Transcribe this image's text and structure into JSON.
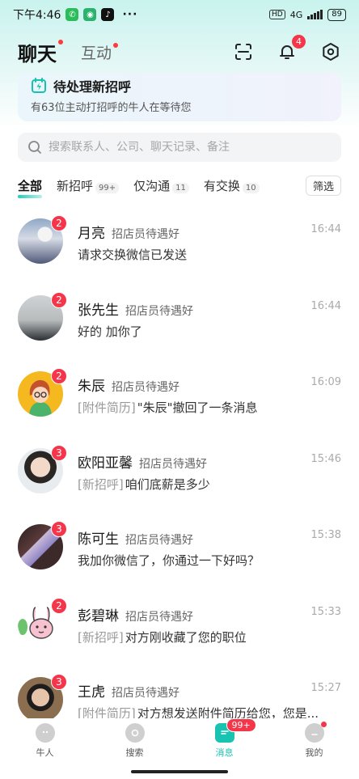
{
  "status_bar": {
    "time": "下午4:46",
    "hd": "HD",
    "network": "4G",
    "battery": "89"
  },
  "header": {
    "tab_chat": "聊天",
    "tab_interact": "互动",
    "notification_count": "4"
  },
  "pending_card": {
    "title": "待处理新招呼",
    "subtitle": "有63位主动打招呼的牛人在等待您"
  },
  "search": {
    "placeholder": "搜索联系人、公司、聊天记录、备注"
  },
  "filter_tabs": [
    {
      "label": "全部",
      "count": ""
    },
    {
      "label": "新招呼",
      "count": "99+"
    },
    {
      "label": "仅沟通",
      "count": "11"
    },
    {
      "label": "有交换",
      "count": "10"
    }
  ],
  "filter_button": "筛选",
  "chats": [
    {
      "name": "月亮",
      "role": "招店员待遇好",
      "time": "16:44",
      "unread": "2",
      "tag": "",
      "message": "请求交换微信已发送"
    },
    {
      "name": "张先生",
      "role": "招店员待遇好",
      "time": "16:44",
      "unread": "2",
      "tag": "",
      "message": "好的 加你了"
    },
    {
      "name": "朱辰",
      "role": "招店员待遇好",
      "time": "16:09",
      "unread": "2",
      "tag": "[附件简历]",
      "message": "\"朱辰\"撤回了一条消息"
    },
    {
      "name": "欧阳亚馨",
      "role": "招店员待遇好",
      "time": "15:46",
      "unread": "3",
      "tag": "[新招呼]",
      "message": "咱们底薪是多少"
    },
    {
      "name": "陈可生",
      "role": "招店员待遇好",
      "time": "15:38",
      "unread": "3",
      "tag": "",
      "message": "我加你微信了，你通过一下好吗？"
    },
    {
      "name": "彭碧琳",
      "role": "招店员待遇好",
      "time": "15:33",
      "unread": "2",
      "tag": "[新招呼]",
      "message": "对方刚收藏了您的职位"
    },
    {
      "name": "王虎",
      "role": "招店员待遇好",
      "time": "15:27",
      "unread": "3",
      "tag": "[附件简历]",
      "message": "对方想发送附件简历给您，您是..."
    }
  ],
  "bottom_nav": [
    {
      "label": "牛人",
      "badge": ""
    },
    {
      "label": "搜索",
      "badge": ""
    },
    {
      "label": "消息",
      "badge": "99+"
    },
    {
      "label": "我的",
      "badge": ""
    }
  ],
  "colors": {
    "accent": "#19c3b1",
    "badge": "#f5364a"
  }
}
